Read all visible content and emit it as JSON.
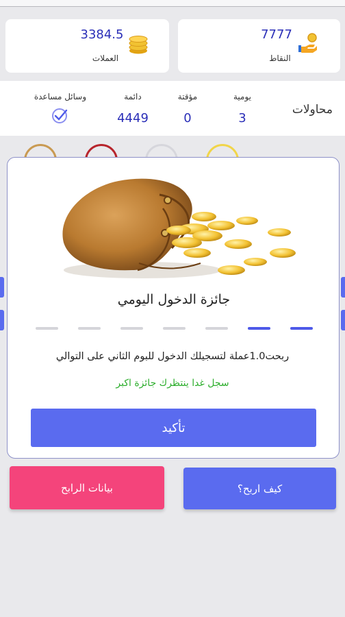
{
  "stats": {
    "coins": {
      "value": "3384.5",
      "label": "العملات"
    },
    "points": {
      "value": "7777",
      "label": "النقاط"
    }
  },
  "attempts": {
    "title": "محاولات",
    "daily": {
      "label": "يومية",
      "value": "3"
    },
    "temporary": {
      "label": "مؤقتة",
      "value": "0"
    },
    "permanent": {
      "label": "دائمة",
      "value": "4449"
    },
    "helpers": {
      "label": "وسائل مساعدة"
    }
  },
  "modal": {
    "title": "جائزة الدخول اليومي",
    "message": "ربحت1.0عملة لتسجيلك الدخول للبوم الثاني على التوالي",
    "sub_message": "سجل غدا ينتظرك جائزة اكبر",
    "confirm_label": "تأكيد",
    "progress": {
      "total_days": 7,
      "completed_days": 2
    }
  },
  "buttons": {
    "how_to_win": "كيف اربح؟",
    "winner_data": "بيانات الرابح"
  },
  "colors": {
    "accent": "#5a6bef",
    "number": "#2b2fb8",
    "pink": "#f4447b",
    "green": "#2dae2d",
    "coin": "#f1c232"
  }
}
